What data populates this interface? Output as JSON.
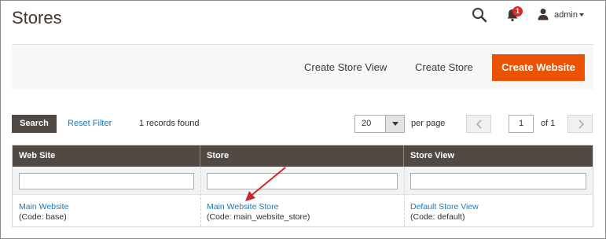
{
  "header": {
    "title": "Stores",
    "notification_count": "1",
    "user_name": "admin"
  },
  "actions": {
    "create_store_view": "Create Store View",
    "create_store": "Create Store",
    "create_website": "Create Website"
  },
  "toolbar": {
    "search_label": "Search",
    "reset_filter_label": "Reset Filter",
    "records_found": "1 records found",
    "per_page_value": "20",
    "per_page_label": "per page",
    "current_page": "1",
    "total_pages_label": "of 1"
  },
  "grid": {
    "columns": [
      "Web Site",
      "Store",
      "Store View"
    ],
    "rows": [
      {
        "website_name": "Main Website",
        "website_code": "(Code: base)",
        "store_name": "Main Website Store",
        "store_code": "(Code: main_website_store)",
        "view_name": "Default Store View",
        "view_code": "(Code: default)"
      }
    ]
  },
  "colors": {
    "accent": "#eb5202",
    "link": "#1979c3",
    "header_bg": "#514943",
    "badge": "#e22626",
    "annotation": "#d0262b"
  }
}
